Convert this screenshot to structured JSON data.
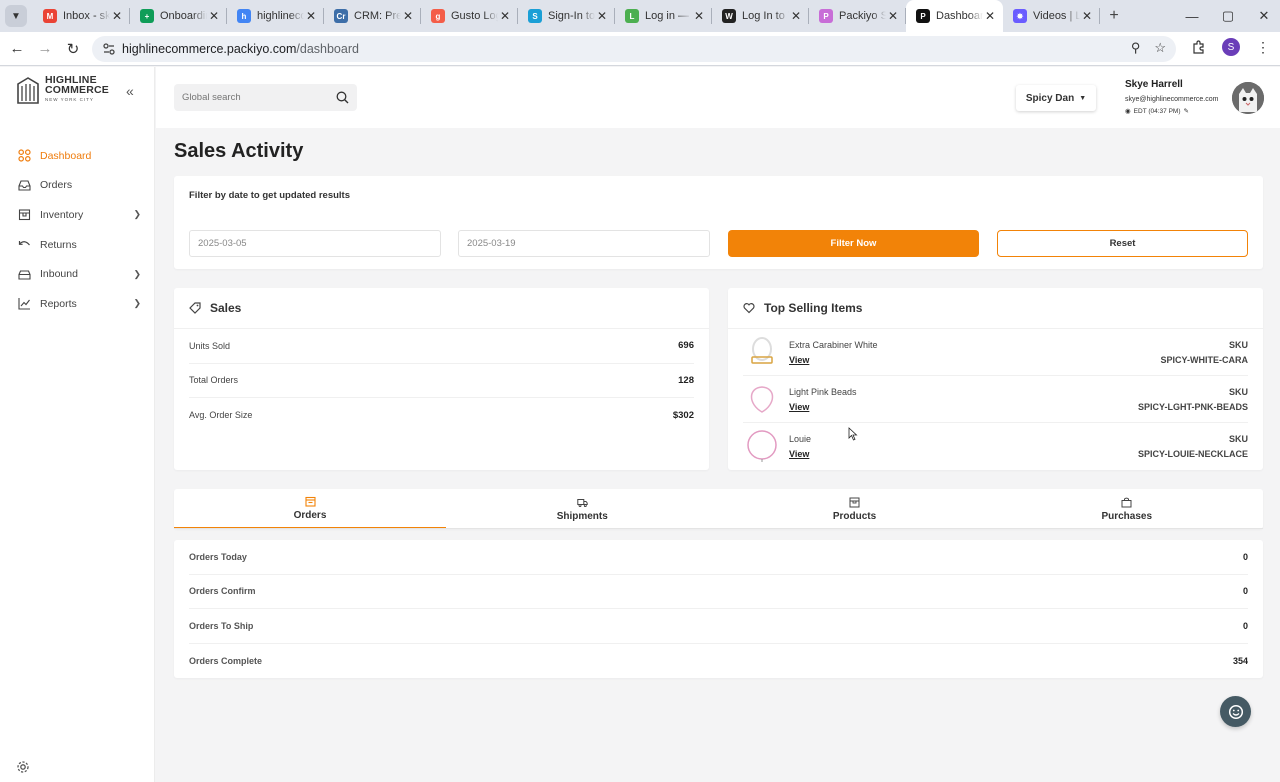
{
  "browser": {
    "tabs": [
      {
        "title": "Inbox - skye",
        "color": "#ea4335",
        "glyph": "M"
      },
      {
        "title": "Onboarding",
        "color": "#0f9d58",
        "glyph": "+"
      },
      {
        "title": "highlinecommerce",
        "color": "#4285f4",
        "glyph": "h"
      },
      {
        "title": "CRM: Pre",
        "color": "#3d6ea8",
        "glyph": "Cr"
      },
      {
        "title": "Gusto Login",
        "color": "#f45d48",
        "glyph": "g"
      },
      {
        "title": "Sign-In to",
        "color": "#1a9fd6",
        "glyph": "S"
      },
      {
        "title": "Log in — ",
        "color": "#4caf50",
        "glyph": "L"
      },
      {
        "title": "Log In to Y",
        "color": "#222222",
        "glyph": "W"
      },
      {
        "title": "Packiyo Su",
        "color": "#c86dd7",
        "glyph": "P"
      },
      {
        "title": "Dashboard",
        "color": "#111111",
        "glyph": "P"
      },
      {
        "title": "Videos | Lo",
        "color": "#6a5cff",
        "glyph": "✸"
      }
    ],
    "active_tab_index": 9,
    "url_host": "highlinecommerce.packiyo.com",
    "url_path": "/dashboard",
    "profile_initial": "S"
  },
  "sidebar": {
    "logo_line1": "HIGHLINE",
    "logo_line2": "COMMERCE",
    "logo_sub": "NEW YORK CITY",
    "items": [
      {
        "label": "Dashboard",
        "icon": "dashboard-icon",
        "active": true,
        "has_children": false
      },
      {
        "label": "Orders",
        "icon": "inbox-icon",
        "active": false,
        "has_children": false
      },
      {
        "label": "Inventory",
        "icon": "box-icon",
        "active": false,
        "has_children": true
      },
      {
        "label": "Returns",
        "icon": "return-icon",
        "active": false,
        "has_children": false
      },
      {
        "label": "Inbound",
        "icon": "inbound-icon",
        "active": false,
        "has_children": true
      },
      {
        "label": "Reports",
        "icon": "chart-icon",
        "active": false,
        "has_children": true
      }
    ]
  },
  "topbar": {
    "search_placeholder": "Global search",
    "account_label": "Spicy Dan",
    "user_name": "Skye Harrell",
    "user_email": "skye@highlinecommerce.com",
    "user_timezone": "EDT (04:37 PM)"
  },
  "main": {
    "title": "Sales Activity",
    "filter": {
      "hint": "Filter by date to get updated results",
      "start_date": "2025-03-05",
      "end_date": "2025-03-19",
      "filter_label": "Filter Now",
      "reset_label": "Reset"
    },
    "sales": {
      "title": "Sales",
      "rows": [
        {
          "label": "Units Sold",
          "value": "696"
        },
        {
          "label": "Total Orders",
          "value": "128"
        },
        {
          "label": "Avg. Order Size",
          "value": "$302"
        }
      ]
    },
    "top_selling": {
      "title": "Top Selling Items",
      "items": [
        {
          "name": "Extra Carabiner White",
          "view_label": "View",
          "sku_label": "SKU",
          "sku": "SPICY-WHITE-CARA"
        },
        {
          "name": "Light Pink Beads",
          "view_label": "View",
          "sku_label": "SKU",
          "sku": "SPICY-LGHT-PNK-BEADS"
        },
        {
          "name": "Louie",
          "view_label": "View",
          "sku_label": "SKU",
          "sku": "SPICY-LOUIE-NECKLACE"
        }
      ]
    },
    "tabs": [
      {
        "label": "Orders",
        "active": true
      },
      {
        "label": "Shipments",
        "active": false
      },
      {
        "label": "Products",
        "active": false
      },
      {
        "label": "Purchases",
        "active": false
      }
    ],
    "orders": [
      {
        "label": "Orders Today",
        "value": "0"
      },
      {
        "label": "Orders Confirm",
        "value": "0"
      },
      {
        "label": "Orders To Ship",
        "value": "0"
      },
      {
        "label": "Orders Complete",
        "value": "354"
      }
    ]
  },
  "colors": {
    "accent": "#f28308",
    "sidebar_active": "#ef7c0c"
  }
}
